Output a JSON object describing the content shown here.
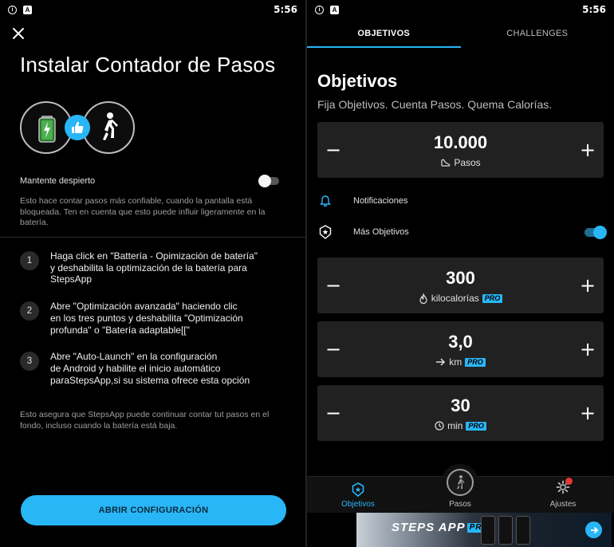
{
  "status_bar": {
    "time": "5:56",
    "icon_a": "A",
    "icon_info": "i"
  },
  "left": {
    "title": "Instalar Contador de Pasos",
    "keep_awake": {
      "label": "Mantente despierto",
      "enabled": false,
      "description": "Esto hace contar pasos más confiable, cuando la pantalla está bloqueada. Ten en cuenta que esto puede influir ligeramente en la batería."
    },
    "steps": [
      {
        "num": "1",
        "text": "Haga click en \"Battería - Opimización de batería\"\ny deshabilita la optimización de la batería para\nStepsApp"
      },
      {
        "num": "2",
        "text": "Abre \"Optimización avanzada\" haciendo clic\nen los tres puntos y deshabilita \"Optimización\nprofunda\" o \"Batería adaptable[[\""
      },
      {
        "num": "3",
        "text": "Abre \"Auto-Launch\" en la configuración\nde Android y habilite el inicio automático\nparaStepsApp,si su sistema ofrece esta opción"
      }
    ],
    "footnote": "Esto asegura que StepsApp puede continuar contar tut pasos en el fondo, incluso cuando la batería está baja.",
    "cta_label": "ABRIR CONFIGURACIÓN"
  },
  "right": {
    "tabs": [
      {
        "label": "OBJETIVOS",
        "active": true
      },
      {
        "label": "CHALLENGES",
        "active": false
      }
    ],
    "title": "Objetivos",
    "subtitle": "Fija Objetivos. Cuenta Pasos. Quema Calorías.",
    "goals": [
      {
        "value": "10.000",
        "unit": "Pasos",
        "icon": "shoe-icon",
        "pro": false
      },
      {
        "value": "300",
        "unit": "kilocalorías",
        "icon": "flame-icon",
        "pro": true
      },
      {
        "value": "3,0",
        "unit": "km",
        "icon": "arrow-right-icon",
        "pro": true
      },
      {
        "value": "30",
        "unit": "min",
        "icon": "clock-icon",
        "pro": true
      }
    ],
    "pro_label": "PRO",
    "notifications_label": "Notificaciones",
    "more_goals": {
      "label": "Más Objetivos",
      "enabled": true
    },
    "nav": {
      "objetivos": "Objetivos",
      "pasos": "Pasos",
      "ajustes": "Ajustes"
    },
    "ad": {
      "brand": "STEPS APP",
      "pro": "PRO"
    }
  },
  "colors": {
    "accent": "#29b6f6",
    "card": "#212121",
    "background": "#000000"
  }
}
